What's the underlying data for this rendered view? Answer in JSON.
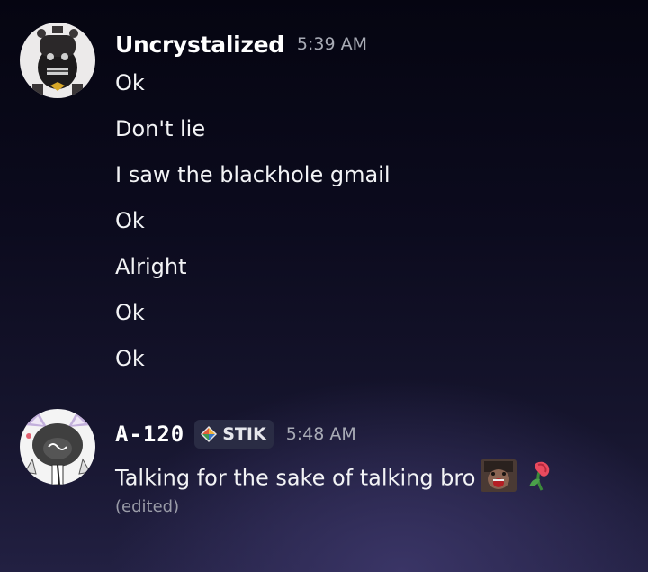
{
  "messages": [
    {
      "username": "Uncrystalized",
      "timestamp": "5:39 AM",
      "lines": [
        "Ok",
        "Don't lie",
        "I saw the blackhole gmail",
        "Ok",
        "Alright",
        "Ok",
        "Ok"
      ]
    },
    {
      "username": "A-120",
      "tag": "STIK",
      "timestamp": "5:48 AM",
      "text": "Talking for the sake of talking bro",
      "edited": "(edited)"
    }
  ],
  "colors": {
    "text": "#f2f3f5",
    "muted": "#a8abb5",
    "tag_bg": "#2a2c44"
  }
}
